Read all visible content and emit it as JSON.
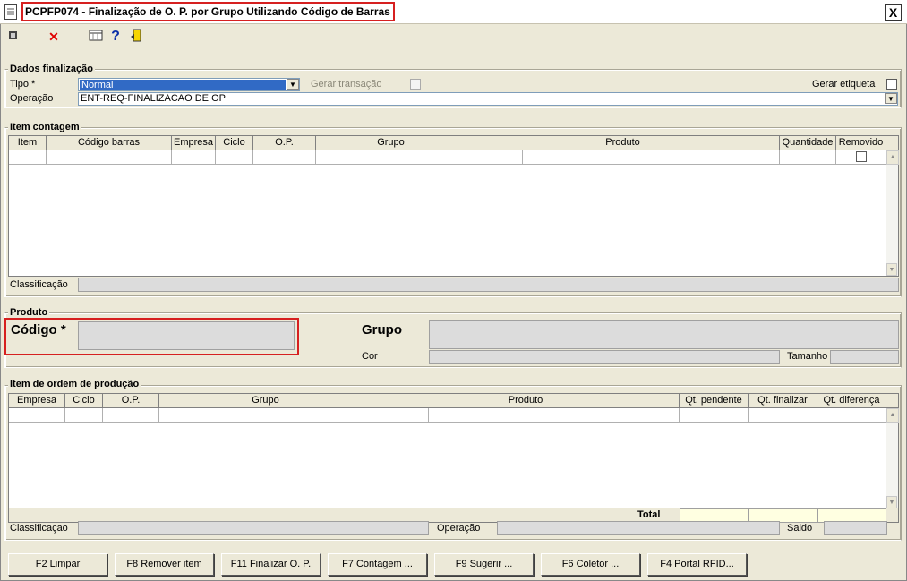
{
  "window": {
    "title": "PCPFP074 - Finalização de O. P.  por Grupo Utilizando Código de Barras",
    "close": "X"
  },
  "toolbar": {
    "icons": [
      "export-icon",
      "cancel-icon",
      "calendar-grid-icon",
      "help-icon",
      "exit-door-icon"
    ],
    "help_glyph": "?",
    "cancel_glyph": "✕"
  },
  "dados": {
    "legend": "Dados finalização",
    "tipo_label": "Tipo *",
    "tipo_value": "Normal",
    "gerar_transacao": "Gerar transação",
    "gerar_etiqueta": "Gerar etiqueta",
    "operacao_label": "Operação",
    "operacao_value": "ENT-REQ-FINALIZACAO DE OP"
  },
  "item_contagem": {
    "legend": "Item contagem",
    "columns": [
      "Item",
      "Código barras",
      "Empresa",
      "Ciclo",
      "O.P.",
      "Grupo",
      "Produto",
      "Quantidade",
      "Removido"
    ],
    "classificacao_label": "Classificação"
  },
  "produto": {
    "legend": "Produto",
    "codigo_label": "Código *",
    "grupo_label": "Grupo",
    "cor_label": "Cor",
    "tamanho_label": "Tamanho"
  },
  "item_ordem": {
    "legend": "Item de ordem de produção",
    "columns": [
      "Empresa",
      "Ciclo",
      "O.P.",
      "Grupo",
      "Produto",
      "Qt. pendente",
      "Qt. finalizar",
      "Qt. diferença"
    ],
    "total_label": "Total",
    "classificacao_label": "Classificaçao",
    "operacao_label": "Operação",
    "saldo_label": "Saldo"
  },
  "buttons": [
    "F2 Limpar",
    "F8 Remover item",
    "F11 Finalizar O. P.",
    "F7 Contagem ...",
    "F9 Sugerir ...",
    "F6 Coletor ...",
    "F4 Portal RFID..."
  ],
  "colors": {
    "accent_red": "#d62020",
    "selection_blue": "#316ac5",
    "total_yellow": "#ffffe1"
  }
}
